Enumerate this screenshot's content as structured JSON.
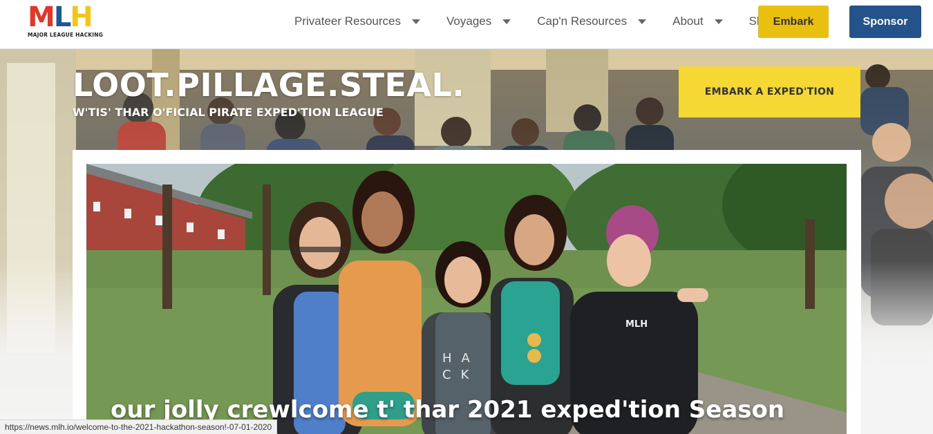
{
  "nav": {
    "logo_letters": [
      "M",
      "L",
      "H"
    ],
    "logo_tagline": "MAJOR LEAGUE HACKING",
    "menu": [
      {
        "label": "Privateer Resources",
        "dropdown": true
      },
      {
        "label": "Voyages",
        "dropdown": true
      },
      {
        "label": "Cap'n Resources",
        "dropdown": true
      },
      {
        "label": "About",
        "dropdown": true
      },
      {
        "label": "Shop",
        "dropdown": false
      }
    ],
    "embark_label": "Embark",
    "sponsor_label": "Sponsor"
  },
  "hero": {
    "title": "LOOT.PILLAGE.STEAL.",
    "subtitle": "W'TIS' THAR O'FICIAL PIRATE EXPED'TION LEAGUE",
    "cta_label": "EMBARK A EXPED'TION"
  },
  "featured": {
    "title": "our jolly crewlcome t' thar 2021 exped'tion Season",
    "photo_text": [
      "H",
      "A",
      "C",
      "K"
    ],
    "badge_text": "MLH"
  },
  "status_bar": {
    "url": "https://news.mlh.io/welcome-to-the-2021-hackathon-season!-07-01-2020"
  },
  "colors": {
    "logo_red": "#e73427",
    "logo_blue": "#1e5799",
    "logo_yellow": "#f3c41b",
    "embark_yellow": "#e9c010",
    "sponsor_blue": "#24528a",
    "cta_yellow": "#f5d833"
  }
}
